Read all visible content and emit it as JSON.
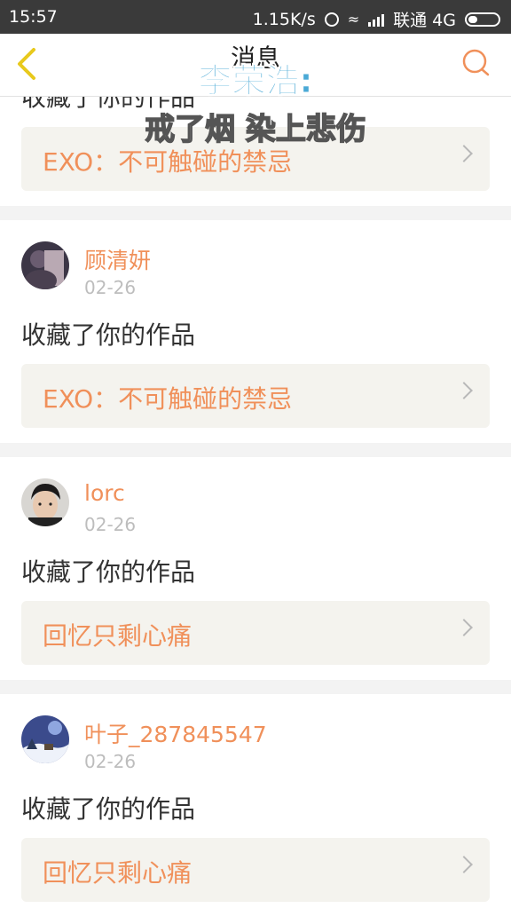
{
  "status_bar": {
    "time": "15:57",
    "speed": "1.15K/s",
    "carrier": "联通 4G"
  },
  "header": {
    "title": "消息"
  },
  "overlay": {
    "line1": "李荣浩:",
    "line2": "戒了烟 染上悲伤"
  },
  "top_partial": {
    "action": "收藏了你的作品",
    "work_title": "EXO：不可触碰的禁忌"
  },
  "items": [
    {
      "user": "顾清妍",
      "date": "02-26",
      "action": "收藏了你的作品",
      "work_title": "EXO：不可触碰的禁忌",
      "avatar": "avatar-dark-photo"
    },
    {
      "user": "lorc",
      "date": "02-26",
      "action": "收藏了你的作品",
      "work_title": "回忆只剩心痛",
      "avatar": "avatar-portrait"
    },
    {
      "user": "叶子_287845547",
      "date": "02-26",
      "action": "收藏了你的作品",
      "work_title": "回忆只剩心痛",
      "avatar": "avatar-snow-scene"
    }
  ],
  "colors": {
    "accent": "#f0905a",
    "card_bg": "#f4f3ee",
    "overlay_blue": "#4aa9d6"
  }
}
